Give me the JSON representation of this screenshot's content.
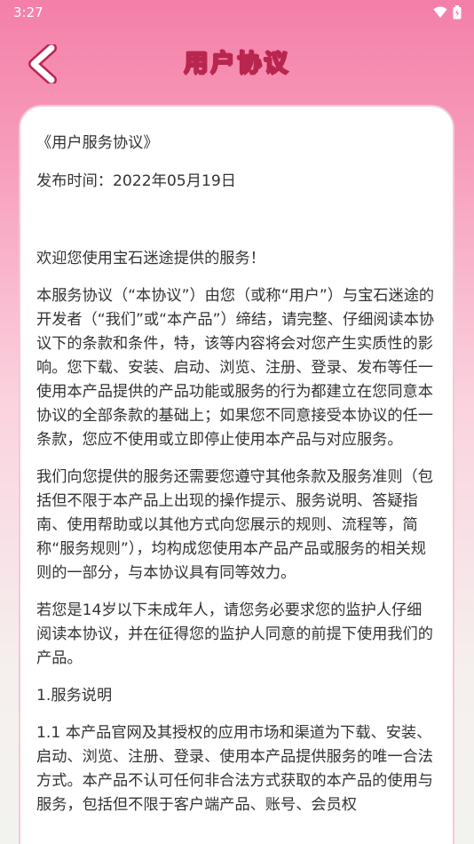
{
  "status_bar": {
    "time": "3:27",
    "icons": [
      "wifi-icon",
      "battery-icon"
    ]
  },
  "header": {
    "title": "用户协议",
    "back_icon": "chevron-left-icon"
  },
  "colors": {
    "header_gradient_top": "#f47fa8",
    "title_stroke": "#b8264f",
    "back_arrow_fill": "#ffffff",
    "back_arrow_stroke": "#b8264f",
    "card_background": "#ffffff",
    "body_text": "#333333"
  },
  "document": {
    "title": "《用户服务协议》",
    "publish_date": "发布时间：2022年05月19日",
    "paragraphs": [
      "欢迎您使用宝石迷途提供的服务！",
      "本服务协议（“本协议”）由您（或称“用户”）与宝石迷途的开发者（“我们”或“本产品”）缔结，请完整、仔细阅读本协议下的条款和条件，特，该等内容将会对您产生实质性的影响。您下载、安装、启动、浏览、注册、登录、发布等任一使用本产品提供的产品功能或服务的行为都建立在您同意本协议的全部条款的基础上；如果您不同意接受本协议的任一条款，您应不使用或立即停止使用本产品与对应服务。",
      "我们向您提供的服务还需要您遵守其他条款及服务准则（包括但不限于本产品上出现的操作提示、服务说明、答疑指南、使用帮助或以其他方式向您展示的规则、流程等，简称“服务规则”），均构成您使用本产品产品或服务的相关规则的一部分，与本协议具有同等效力。",
      "若您是14岁以下未成年人，请您务必要求您的监护人仔细阅读本协议，并在征得您的监护人同意的前提下使用我们的产品。",
      "1.服务说明",
      "1.1 本产品官网及其授权的应用市场和渠道为下载、安装、启动、浏览、注册、登录、使用本产品提供服务的唯一合法方式。本产品不认可任何非合法方式获取的本产品的使用与服务，包括但不限于客户端产品、账号、会员权"
    ]
  }
}
